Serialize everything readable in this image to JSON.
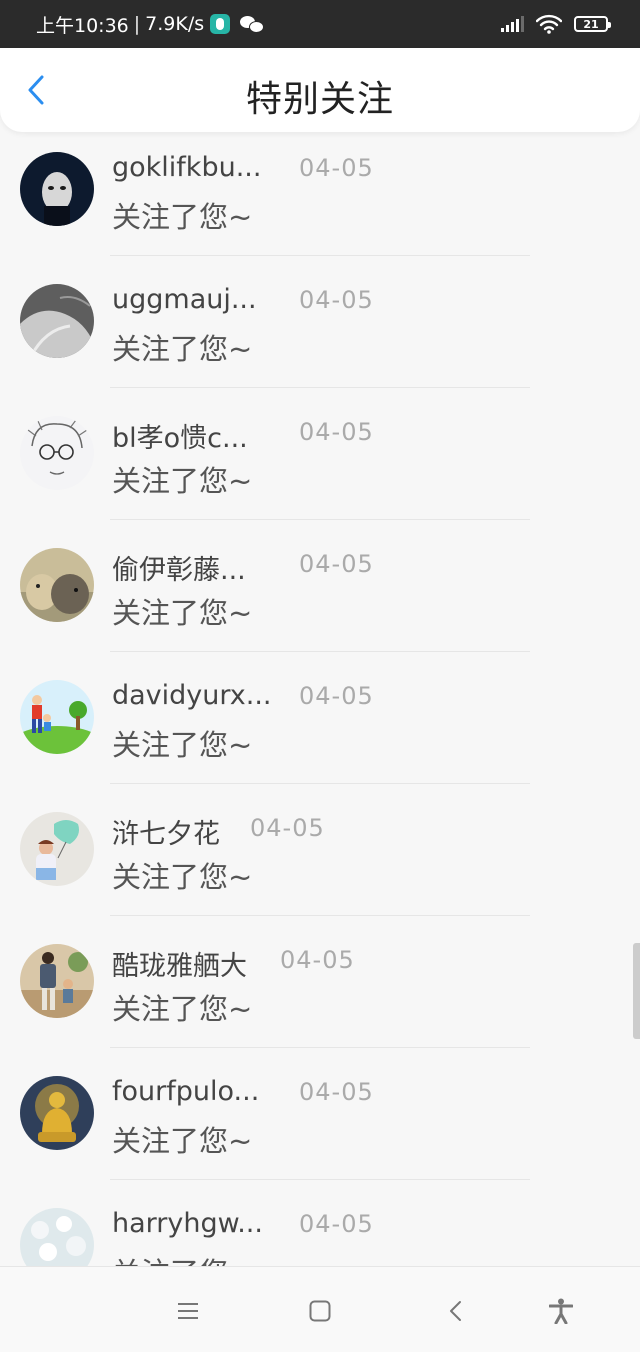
{
  "status_bar": {
    "time": "上午10:36",
    "network_speed": "7.9K/s",
    "battery": "21",
    "icons": [
      "app-badge-icon",
      "wechat-icon",
      "signal-icon",
      "wifi-icon",
      "battery-icon"
    ]
  },
  "header": {
    "title": "特别关注",
    "back_icon": "chevron-left-icon",
    "accent": "#2b8ef0"
  },
  "items": [
    {
      "name": "goklifkbu...",
      "date": "04-05",
      "message": "关注了您~",
      "avatar": "mask-face"
    },
    {
      "name": "uggmauj...",
      "date": "04-05",
      "message": "关注了您~",
      "avatar": "shoulder"
    },
    {
      "name": "bl孝o愦c...",
      "date": "04-05",
      "message": "关注了您~",
      "avatar": "sketch-glasses"
    },
    {
      "name": "偷伊彰藤...",
      "date": "04-05",
      "message": "关注了您~",
      "avatar": "rabbits"
    },
    {
      "name": "davidyurx...",
      "date": "04-05",
      "message": "关注了您~",
      "avatar": "cartoon-kids"
    },
    {
      "name": "浒七夕花",
      "date": "04-05",
      "message": "关注了您~",
      "avatar": "girl-balloon"
    },
    {
      "name": "酷珑雅舾大",
      "date": "04-05",
      "message": "关注了您~",
      "avatar": "family-walk"
    },
    {
      "name": "fourfpulo...",
      "date": "04-05",
      "message": "关注了您~",
      "avatar": "buddha"
    },
    {
      "name": "harryhgw...",
      "date": "04-05",
      "message": "关注了您~",
      "avatar": "flowers"
    }
  ],
  "nav_bar": {
    "icons": [
      "menu-icon",
      "home-icon",
      "back-icon",
      "accessibility-icon"
    ]
  }
}
